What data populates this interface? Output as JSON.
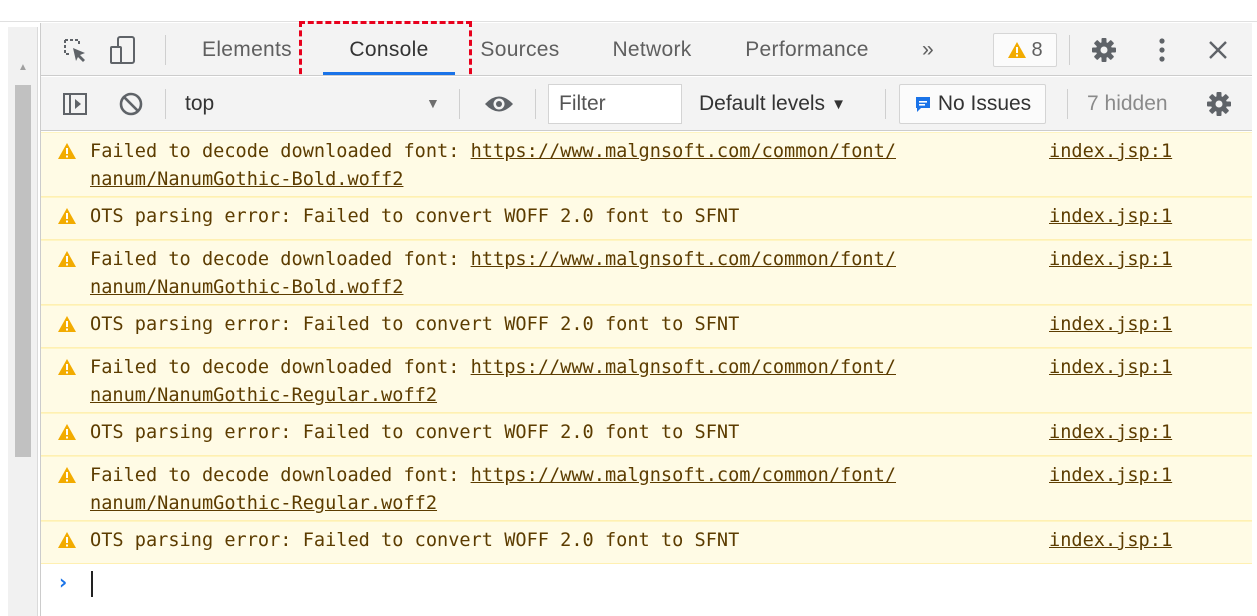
{
  "tabs": [
    {
      "label": "Elements"
    },
    {
      "label": "Console"
    },
    {
      "label": "Sources"
    },
    {
      "label": "Network"
    },
    {
      "label": "Performance"
    }
  ],
  "tabbar": {
    "more_tabs": "»",
    "warning_count": "8"
  },
  "toolbar": {
    "context": "top",
    "filter_placeholder": "Filter",
    "levels_label": "Default levels",
    "issues_label": "No Issues",
    "hidden_label": "7 hidden"
  },
  "messages": [
    {
      "prefix": "Failed to decode downloaded font: ",
      "url": "https://www.malgnsoft.com/common/font/",
      "cont": "nanum/NanumGothic-Bold.woff2",
      "source": "index.jsp:1"
    },
    {
      "text": "OTS parsing error: Failed to convert WOFF 2.0 font to SFNT",
      "source": "index.jsp:1"
    },
    {
      "prefix": "Failed to decode downloaded font: ",
      "url": "https://www.malgnsoft.com/common/font/",
      "cont": "nanum/NanumGothic-Bold.woff2",
      "source": "index.jsp:1"
    },
    {
      "text": "OTS parsing error: Failed to convert WOFF 2.0 font to SFNT",
      "source": "index.jsp:1"
    },
    {
      "prefix": "Failed to decode downloaded font: ",
      "url": "https://www.malgnsoft.com/common/font/",
      "cont": "nanum/NanumGothic-Regular.woff2",
      "source": "index.jsp:1"
    },
    {
      "text": "OTS parsing error: Failed to convert WOFF 2.0 font to SFNT",
      "source": "index.jsp:1"
    },
    {
      "prefix": "Failed to decode downloaded font: ",
      "url": "https://www.malgnsoft.com/common/font/",
      "cont": "nanum/NanumGothic-Regular.woff2",
      "source": "index.jsp:1"
    },
    {
      "text": "OTS parsing error: Failed to convert WOFF 2.0 font to SFNT",
      "source": "index.jsp:1"
    }
  ],
  "colors": {
    "accent": "#1a73e8",
    "warning_bg": "#fffbe5",
    "warning_text": "#5c3c00",
    "warning_icon": "#f2ab00",
    "highlight": "#e8001c"
  },
  "icons": {
    "inspect": "inspect-icon",
    "device": "device-toggle-icon",
    "sidebar": "sidebar-toggle-icon",
    "clear": "clear-console-icon",
    "eye": "eye-icon",
    "settings": "gear-icon",
    "more": "kebab-menu-icon",
    "close": "close-icon",
    "warning": "warning-icon",
    "issues": "issues-icon"
  }
}
